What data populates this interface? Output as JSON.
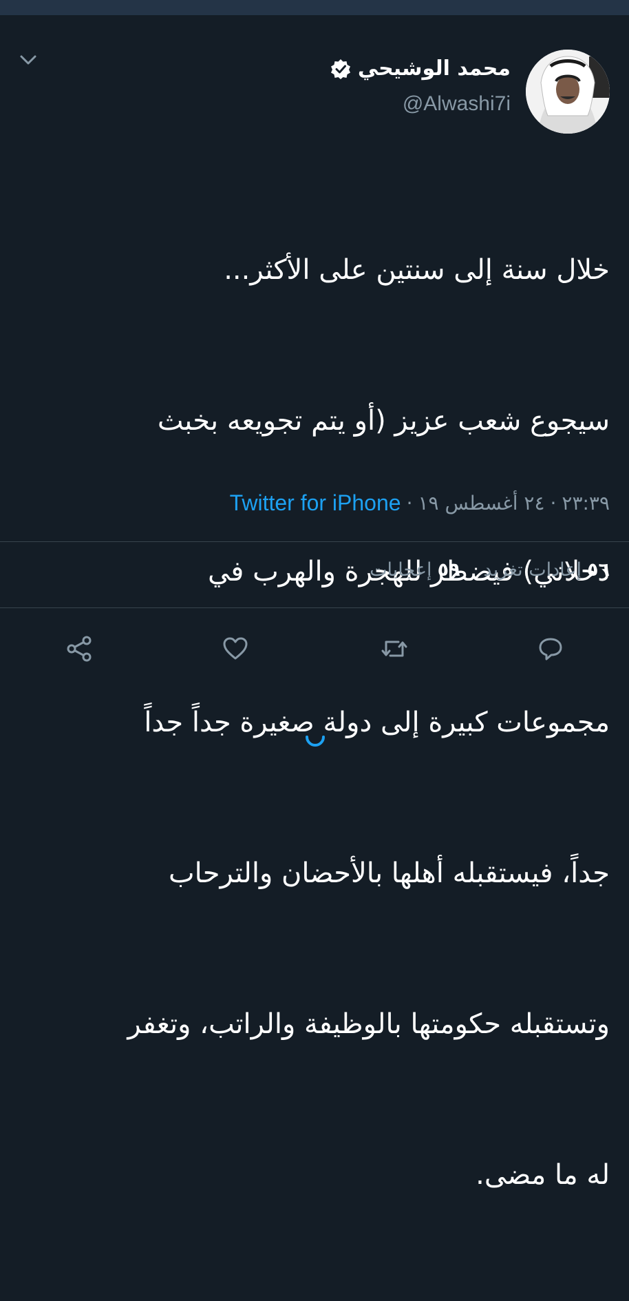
{
  "tweet": {
    "display_name": "محمد الوشيحي",
    "handle": "@Alwashi7i",
    "lines": [
      "خلال سنة إلى سنتين على الأكثر...",
      "سيجوع شعب عزيز (أو يتم تجويعه بخبث",
      "دحلاني) فيضطر للهجرة والهرب في",
      "مجموعات كبيرة إلى دولة صغيرة جداً جداً",
      "جداً، فيستقبله أهلها بالأحضان والترحاب",
      "وتستقبله حكومتها بالوظيفة والراتب، وتغفر",
      "له ما مضى."
    ],
    "time": "٢٣:٣٩",
    "date": "٢٤ أغسطس ١٩",
    "separator": "·",
    "source": "Twitter for iPhone"
  },
  "stats": {
    "retweets_count": "٥٦",
    "retweets_label": "إعادات تغريد",
    "likes_count": "٥٩",
    "likes_label": "إعجابات"
  },
  "icons": {
    "verified": "verified-badge-icon",
    "menu": "chevron-down-icon",
    "reply": "reply-icon",
    "retweet": "retweet-icon",
    "like": "heart-icon",
    "share": "share-icon",
    "loading": "spinner-icon"
  },
  "colors": {
    "background": "#141d26",
    "accent": "#1da1f2",
    "muted": "#8899a6",
    "divider": "#38444d"
  }
}
